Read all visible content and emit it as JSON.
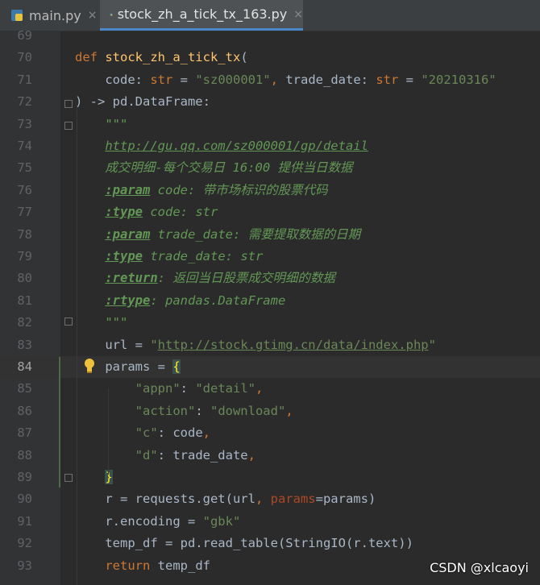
{
  "tabs": [
    {
      "label": "main.py",
      "close": "×",
      "active": false
    },
    {
      "label": "stock_zh_a_tick_tx_163.py",
      "close": "×",
      "active": true
    }
  ],
  "lines": [
    {
      "num": "69",
      "segs": []
    },
    {
      "num": "70",
      "segs": [
        {
          "c": "kw",
          "t": "def "
        },
        {
          "c": "fn",
          "t": "stock_zh_a_tick_tx"
        },
        {
          "c": "",
          "t": "("
        }
      ]
    },
    {
      "num": "71",
      "segs": [
        {
          "c": "",
          "t": "    code: "
        },
        {
          "c": "kw",
          "t": "str"
        },
        {
          "c": "",
          "t": " = "
        },
        {
          "c": "str",
          "t": "\"sz000001\""
        },
        {
          "c": "kw",
          "t": ","
        },
        {
          "c": "",
          "t": " trade_date: "
        },
        {
          "c": "kw",
          "t": "str"
        },
        {
          "c": "",
          "t": " = "
        },
        {
          "c": "str",
          "t": "\"20210316\""
        }
      ]
    },
    {
      "num": "72",
      "segs": [
        {
          "c": "",
          "t": ") -> pd.DataFrame:"
        }
      ]
    },
    {
      "num": "73",
      "segs": [
        {
          "c": "doc",
          "t": "    \"\"\""
        }
      ]
    },
    {
      "num": "74",
      "segs": [
        {
          "c": "doc",
          "t": "    "
        },
        {
          "c": "doc link",
          "t": "http://gu.qq.com/sz000001/gp/detail"
        }
      ]
    },
    {
      "num": "75",
      "segs": [
        {
          "c": "doc",
          "t": "    成交明细-每个交易日 16:00 提供当日数据"
        }
      ]
    },
    {
      "num": "76",
      "segs": [
        {
          "c": "doc",
          "t": "    "
        },
        {
          "c": "doctag",
          "t": ":param"
        },
        {
          "c": "doc",
          "t": " code: 带市场标识的股票代码"
        }
      ]
    },
    {
      "num": "77",
      "segs": [
        {
          "c": "doc",
          "t": "    "
        },
        {
          "c": "doctag",
          "t": ":type"
        },
        {
          "c": "doc",
          "t": " code: str"
        }
      ]
    },
    {
      "num": "78",
      "segs": [
        {
          "c": "doc",
          "t": "    "
        },
        {
          "c": "doctag",
          "t": ":param"
        },
        {
          "c": "doc",
          "t": " trade_date: 需要提取数据的日期"
        }
      ]
    },
    {
      "num": "79",
      "segs": [
        {
          "c": "doc",
          "t": "    "
        },
        {
          "c": "doctag",
          "t": ":type"
        },
        {
          "c": "doc",
          "t": " trade_date: str"
        }
      ]
    },
    {
      "num": "80",
      "segs": [
        {
          "c": "doc",
          "t": "    "
        },
        {
          "c": "doctag",
          "t": ":return"
        },
        {
          "c": "doc",
          "t": ": 返回当日股票成交明细的数据"
        }
      ]
    },
    {
      "num": "81",
      "segs": [
        {
          "c": "doc",
          "t": "    "
        },
        {
          "c": "doctag",
          "t": ":rtype"
        },
        {
          "c": "doc",
          "t": ": pandas.DataFrame"
        }
      ]
    },
    {
      "num": "82",
      "segs": [
        {
          "c": "doc",
          "t": "    \"\"\""
        }
      ]
    },
    {
      "num": "83",
      "segs": [
        {
          "c": "",
          "t": "    url = "
        },
        {
          "c": "str",
          "t": "\""
        },
        {
          "c": "str link",
          "t": "http://stock.gtimg.cn/data/index.php"
        },
        {
          "c": "str",
          "t": "\""
        }
      ]
    },
    {
      "num": "84",
      "current": true,
      "segs": [
        {
          "c": "",
          "t": "    params = "
        },
        {
          "c": "brace",
          "t": "{"
        }
      ]
    },
    {
      "num": "85",
      "segs": [
        {
          "c": "",
          "t": "        "
        },
        {
          "c": "str",
          "t": "\"appn\""
        },
        {
          "c": "",
          "t": ": "
        },
        {
          "c": "str",
          "t": "\"detail\""
        },
        {
          "c": "kw",
          "t": ","
        }
      ]
    },
    {
      "num": "86",
      "segs": [
        {
          "c": "",
          "t": "        "
        },
        {
          "c": "str",
          "t": "\"action\""
        },
        {
          "c": "",
          "t": ": "
        },
        {
          "c": "str",
          "t": "\"download\""
        },
        {
          "c": "kw",
          "t": ","
        }
      ]
    },
    {
      "num": "87",
      "segs": [
        {
          "c": "",
          "t": "        "
        },
        {
          "c": "str",
          "t": "\"c\""
        },
        {
          "c": "",
          "t": ": code"
        },
        {
          "c": "kw",
          "t": ","
        }
      ]
    },
    {
      "num": "88",
      "segs": [
        {
          "c": "",
          "t": "        "
        },
        {
          "c": "str",
          "t": "\"d\""
        },
        {
          "c": "",
          "t": ": trade_date"
        },
        {
          "c": "kw",
          "t": ","
        }
      ]
    },
    {
      "num": "89",
      "segs": [
        {
          "c": "",
          "t": "    "
        },
        {
          "c": "brace",
          "t": "}"
        }
      ]
    },
    {
      "num": "90",
      "segs": [
        {
          "c": "",
          "t": "    r = requests.get(url"
        },
        {
          "c": "kw",
          "t": ", "
        },
        {
          "c": "param",
          "t": "params"
        },
        {
          "c": "",
          "t": "=params)"
        }
      ]
    },
    {
      "num": "91",
      "segs": [
        {
          "c": "",
          "t": "    r.encoding = "
        },
        {
          "c": "str",
          "t": "\"gbk\""
        }
      ]
    },
    {
      "num": "92",
      "segs": [
        {
          "c": "",
          "t": "    temp_df = pd.read_table(StringIO(r.text))"
        }
      ]
    },
    {
      "num": "93",
      "segs": [
        {
          "c": "kw",
          "t": "    return"
        },
        {
          "c": "",
          "t": " temp_df"
        }
      ]
    }
  ],
  "watermark": "CSDN @xlcaoyi",
  "colors": {
    "background": "#2b2b2b",
    "keyword": "#cc7832",
    "function": "#ffc66d",
    "string": "#6a8759",
    "docstring": "#629755"
  }
}
